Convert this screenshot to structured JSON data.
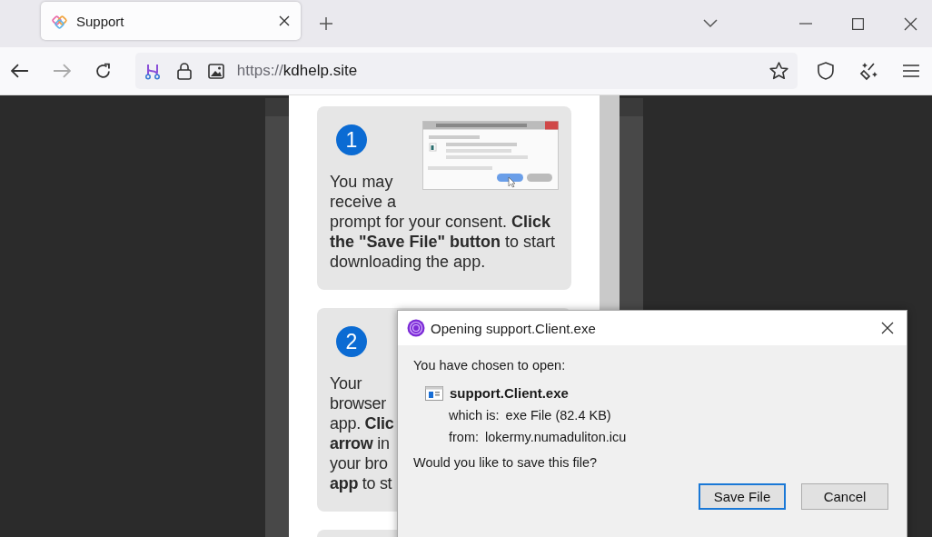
{
  "browser": {
    "tab": {
      "title": "Support",
      "selected": true
    },
    "url_scheme": "https://",
    "url_host": "kdhelp.site"
  },
  "steps": [
    {
      "number": "1",
      "lines": [
        "You may",
        "receive a",
        "prompt for your consent. **Click the \"Save File\" button** to start downloading the app."
      ]
    },
    {
      "number": "2",
      "lines": [
        "Your",
        "browser",
        "app. **Clic**",
        "**arrow** in",
        "your bro",
        "**app** to st"
      ]
    }
  ],
  "dialog": {
    "title": "Opening support.Client.exe",
    "intro": "You have chosen to open:",
    "file_name": "support.Client.exe",
    "type_label": "which is:",
    "type_value": "exe File (82.4 KB)",
    "from_label": "from:",
    "from_value": "lokermy.numaduliton.icu",
    "question": "Would you like to save this file?",
    "buttons": [
      {
        "label": "Save File",
        "selected": true
      },
      {
        "label": "Cancel",
        "selected": false
      }
    ]
  }
}
